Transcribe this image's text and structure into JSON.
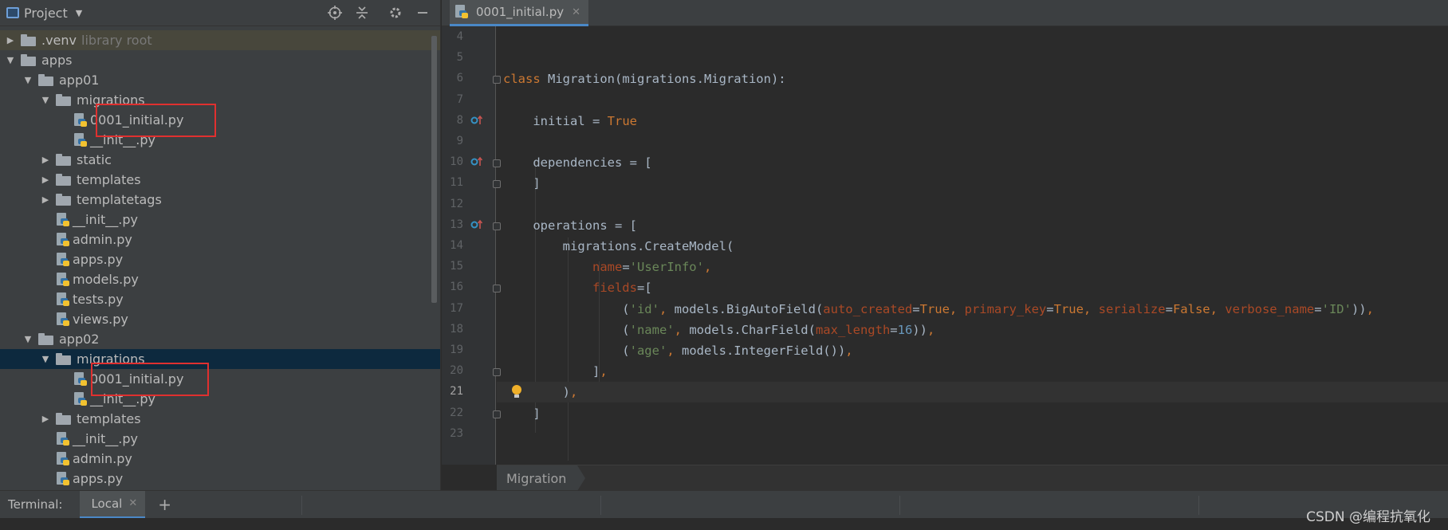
{
  "project_panel": {
    "title": "Project",
    "tree": [
      {
        "label": ".venv",
        "hint": "library root",
        "type": "folder",
        "depth": 1,
        "expanded": false
      },
      {
        "label": "apps",
        "type": "folder",
        "depth": 1,
        "expanded": true
      },
      {
        "label": "app01",
        "type": "folder",
        "depth": 2,
        "expanded": true
      },
      {
        "label": "migrations",
        "type": "folder",
        "depth": 3,
        "expanded": true
      },
      {
        "label": "0001_initial.py",
        "type": "file",
        "depth": 4
      },
      {
        "label": "__init__.py",
        "type": "file",
        "depth": 4
      },
      {
        "label": "static",
        "type": "folder",
        "depth": 3,
        "expanded": false
      },
      {
        "label": "templates",
        "type": "folder",
        "depth": 3,
        "expanded": false
      },
      {
        "label": "templatetags",
        "type": "folder",
        "depth": 3,
        "expanded": false
      },
      {
        "label": "__init__.py",
        "type": "file",
        "depth": 3
      },
      {
        "label": "admin.py",
        "type": "file",
        "depth": 3
      },
      {
        "label": "apps.py",
        "type": "file",
        "depth": 3
      },
      {
        "label": "models.py",
        "type": "file",
        "depth": 3
      },
      {
        "label": "tests.py",
        "type": "file",
        "depth": 3
      },
      {
        "label": "views.py",
        "type": "file",
        "depth": 3
      },
      {
        "label": "app02",
        "type": "folder",
        "depth": 2,
        "expanded": true
      },
      {
        "label": "migrations",
        "type": "folder",
        "depth": 3,
        "expanded": true
      },
      {
        "label": "0001_initial.py",
        "type": "file",
        "depth": 4
      },
      {
        "label": "__init__.py",
        "type": "file",
        "depth": 4
      },
      {
        "label": "templates",
        "type": "folder",
        "depth": 3,
        "expanded": false
      },
      {
        "label": "__init__.py",
        "type": "file",
        "depth": 3
      },
      {
        "label": "admin.py",
        "type": "file",
        "depth": 3
      },
      {
        "label": "apps.py",
        "type": "file",
        "depth": 3
      }
    ]
  },
  "editor": {
    "tab_label": "0001_initial.py",
    "breadcrumb": "Migration",
    "current_line": 21,
    "lines": [
      {
        "no": "4",
        "code": []
      },
      {
        "no": "5",
        "code": []
      },
      {
        "no": "6",
        "code": [
          [
            "kw",
            "class "
          ],
          [
            "",
            "Migration(migrations.Migration):"
          ]
        ]
      },
      {
        "no": "7",
        "code": []
      },
      {
        "no": "8",
        "code": [
          [
            "",
            "    initial = "
          ],
          [
            "kw",
            "True"
          ]
        ]
      },
      {
        "no": "9",
        "code": []
      },
      {
        "no": "10",
        "code": [
          [
            "",
            "    dependencies = ["
          ]
        ]
      },
      {
        "no": "11",
        "code": [
          [
            "",
            "    ]"
          ]
        ]
      },
      {
        "no": "12",
        "code": []
      },
      {
        "no": "13",
        "code": [
          [
            "",
            "    operations = ["
          ]
        ]
      },
      {
        "no": "14",
        "code": [
          [
            "",
            "        migrations.CreateModel("
          ]
        ]
      },
      {
        "no": "15",
        "code": [
          [
            "",
            "            "
          ],
          [
            "param",
            "name"
          ],
          [
            "",
            "="
          ],
          [
            "str",
            "'UserInfo'"
          ],
          [
            "kw",
            ","
          ]
        ]
      },
      {
        "no": "16",
        "code": [
          [
            "",
            "            "
          ],
          [
            "param",
            "fields"
          ],
          [
            "",
            "=["
          ]
        ]
      },
      {
        "no": "17",
        "code": [
          [
            "",
            "                ("
          ],
          [
            "str",
            "'id'"
          ],
          [
            "kw",
            ", "
          ],
          [
            "",
            "models.BigAutoField("
          ],
          [
            "param",
            "auto_created"
          ],
          [
            "",
            "="
          ],
          [
            "kw",
            "True, "
          ],
          [
            "param",
            "primary_key"
          ],
          [
            "",
            "="
          ],
          [
            "kw",
            "True, "
          ],
          [
            "param",
            "serialize"
          ],
          [
            "",
            "="
          ],
          [
            "kw",
            "False, "
          ],
          [
            "param",
            "verbose_name"
          ],
          [
            "",
            "="
          ],
          [
            "str",
            "'ID'"
          ],
          [
            "",
            "))"
          ],
          [
            "kw",
            ","
          ]
        ]
      },
      {
        "no": "18",
        "code": [
          [
            "",
            "                ("
          ],
          [
            "str",
            "'name'"
          ],
          [
            "kw",
            ", "
          ],
          [
            "",
            "models.CharField("
          ],
          [
            "param",
            "max_length"
          ],
          [
            "",
            "="
          ],
          [
            "num",
            "16"
          ],
          [
            "",
            "))"
          ],
          [
            "kw",
            ","
          ]
        ]
      },
      {
        "no": "19",
        "code": [
          [
            "",
            "                ("
          ],
          [
            "str",
            "'age'"
          ],
          [
            "kw",
            ", "
          ],
          [
            "",
            "models.IntegerField())"
          ],
          [
            "kw",
            ","
          ]
        ]
      },
      {
        "no": "20",
        "code": [
          [
            "",
            "            ]"
          ],
          [
            "kw",
            ","
          ]
        ]
      },
      {
        "no": "21",
        "code": [
          [
            "",
            "        )"
          ],
          [
            "kw",
            ","
          ]
        ]
      },
      {
        "no": "22",
        "code": [
          [
            "",
            "    ]"
          ]
        ]
      },
      {
        "no": "23",
        "code": []
      }
    ]
  },
  "terminal": {
    "label": "Terminal:",
    "tab_label": "Local"
  },
  "watermark": "CSDN @编程抗氧化",
  "colors": {
    "keyword": "#cc7832",
    "string": "#6a8759",
    "number": "#6897bb",
    "param": "#aa4926",
    "highlight_box": "#e0302f"
  }
}
